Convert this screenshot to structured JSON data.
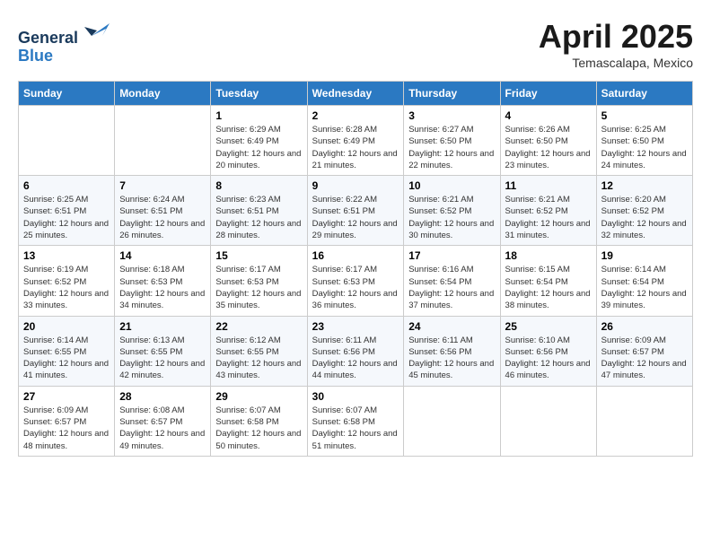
{
  "header": {
    "logo_general": "General",
    "logo_blue": "Blue",
    "month_title": "April 2025",
    "location": "Temascalapa, Mexico"
  },
  "days_of_week": [
    "Sunday",
    "Monday",
    "Tuesday",
    "Wednesday",
    "Thursday",
    "Friday",
    "Saturday"
  ],
  "weeks": [
    [
      {
        "day": null
      },
      {
        "day": null
      },
      {
        "day": 1,
        "sunrise": "6:29 AM",
        "sunset": "6:49 PM",
        "daylight": "12 hours and 20 minutes."
      },
      {
        "day": 2,
        "sunrise": "6:28 AM",
        "sunset": "6:49 PM",
        "daylight": "12 hours and 21 minutes."
      },
      {
        "day": 3,
        "sunrise": "6:27 AM",
        "sunset": "6:50 PM",
        "daylight": "12 hours and 22 minutes."
      },
      {
        "day": 4,
        "sunrise": "6:26 AM",
        "sunset": "6:50 PM",
        "daylight": "12 hours and 23 minutes."
      },
      {
        "day": 5,
        "sunrise": "6:25 AM",
        "sunset": "6:50 PM",
        "daylight": "12 hours and 24 minutes."
      }
    ],
    [
      {
        "day": 6,
        "sunrise": "6:25 AM",
        "sunset": "6:51 PM",
        "daylight": "12 hours and 25 minutes."
      },
      {
        "day": 7,
        "sunrise": "6:24 AM",
        "sunset": "6:51 PM",
        "daylight": "12 hours and 26 minutes."
      },
      {
        "day": 8,
        "sunrise": "6:23 AM",
        "sunset": "6:51 PM",
        "daylight": "12 hours and 28 minutes."
      },
      {
        "day": 9,
        "sunrise": "6:22 AM",
        "sunset": "6:51 PM",
        "daylight": "12 hours and 29 minutes."
      },
      {
        "day": 10,
        "sunrise": "6:21 AM",
        "sunset": "6:52 PM",
        "daylight": "12 hours and 30 minutes."
      },
      {
        "day": 11,
        "sunrise": "6:21 AM",
        "sunset": "6:52 PM",
        "daylight": "12 hours and 31 minutes."
      },
      {
        "day": 12,
        "sunrise": "6:20 AM",
        "sunset": "6:52 PM",
        "daylight": "12 hours and 32 minutes."
      }
    ],
    [
      {
        "day": 13,
        "sunrise": "6:19 AM",
        "sunset": "6:52 PM",
        "daylight": "12 hours and 33 minutes."
      },
      {
        "day": 14,
        "sunrise": "6:18 AM",
        "sunset": "6:53 PM",
        "daylight": "12 hours and 34 minutes."
      },
      {
        "day": 15,
        "sunrise": "6:17 AM",
        "sunset": "6:53 PM",
        "daylight": "12 hours and 35 minutes."
      },
      {
        "day": 16,
        "sunrise": "6:17 AM",
        "sunset": "6:53 PM",
        "daylight": "12 hours and 36 minutes."
      },
      {
        "day": 17,
        "sunrise": "6:16 AM",
        "sunset": "6:54 PM",
        "daylight": "12 hours and 37 minutes."
      },
      {
        "day": 18,
        "sunrise": "6:15 AM",
        "sunset": "6:54 PM",
        "daylight": "12 hours and 38 minutes."
      },
      {
        "day": 19,
        "sunrise": "6:14 AM",
        "sunset": "6:54 PM",
        "daylight": "12 hours and 39 minutes."
      }
    ],
    [
      {
        "day": 20,
        "sunrise": "6:14 AM",
        "sunset": "6:55 PM",
        "daylight": "12 hours and 41 minutes."
      },
      {
        "day": 21,
        "sunrise": "6:13 AM",
        "sunset": "6:55 PM",
        "daylight": "12 hours and 42 minutes."
      },
      {
        "day": 22,
        "sunrise": "6:12 AM",
        "sunset": "6:55 PM",
        "daylight": "12 hours and 43 minutes."
      },
      {
        "day": 23,
        "sunrise": "6:11 AM",
        "sunset": "6:56 PM",
        "daylight": "12 hours and 44 minutes."
      },
      {
        "day": 24,
        "sunrise": "6:11 AM",
        "sunset": "6:56 PM",
        "daylight": "12 hours and 45 minutes."
      },
      {
        "day": 25,
        "sunrise": "6:10 AM",
        "sunset": "6:56 PM",
        "daylight": "12 hours and 46 minutes."
      },
      {
        "day": 26,
        "sunrise": "6:09 AM",
        "sunset": "6:57 PM",
        "daylight": "12 hours and 47 minutes."
      }
    ],
    [
      {
        "day": 27,
        "sunrise": "6:09 AM",
        "sunset": "6:57 PM",
        "daylight": "12 hours and 48 minutes."
      },
      {
        "day": 28,
        "sunrise": "6:08 AM",
        "sunset": "6:57 PM",
        "daylight": "12 hours and 49 minutes."
      },
      {
        "day": 29,
        "sunrise": "6:07 AM",
        "sunset": "6:58 PM",
        "daylight": "12 hours and 50 minutes."
      },
      {
        "day": 30,
        "sunrise": "6:07 AM",
        "sunset": "6:58 PM",
        "daylight": "12 hours and 51 minutes."
      },
      {
        "day": null
      },
      {
        "day": null
      },
      {
        "day": null
      }
    ]
  ]
}
